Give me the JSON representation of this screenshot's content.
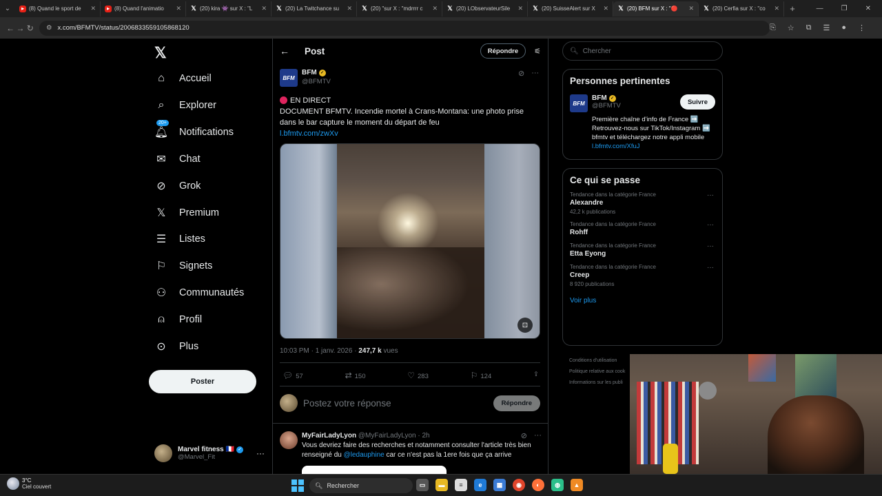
{
  "browser": {
    "tabs": [
      {
        "title": "(8) Quand le sport de",
        "icon": "youtube-icon"
      },
      {
        "title": "(8) Quand l'animatio",
        "icon": "youtube-icon"
      },
      {
        "title": "(20) kira 👾 sur X : \"L",
        "icon": "x-icon"
      },
      {
        "title": "(20) La Twitchance su",
        "icon": "x-icon"
      },
      {
        "title": "(20) \"sur X : \"mdrrrr c",
        "icon": "x-icon"
      },
      {
        "title": "(20) LObservateurSile",
        "icon": "x-icon"
      },
      {
        "title": "(20) SuisseAlert sur X",
        "icon": "x-icon"
      },
      {
        "title": "(20) BFM sur X : \"🔴",
        "icon": "x-icon",
        "active": true
      },
      {
        "title": "(20) Cerfia sur X : \"co",
        "icon": "x-icon"
      }
    ],
    "url": "x.com/BFMTV/status/2006833559105868120"
  },
  "nav": {
    "items": [
      {
        "label": "Accueil",
        "icon": "home-icon"
      },
      {
        "label": "Explorer",
        "icon": "search-icon"
      },
      {
        "label": "Notifications",
        "icon": "bell-icon",
        "badge": "20+"
      },
      {
        "label": "Chat",
        "icon": "mail-icon"
      },
      {
        "label": "Grok",
        "icon": "grok-icon"
      },
      {
        "label": "Premium",
        "icon": "x-logo-icon"
      },
      {
        "label": "Listes",
        "icon": "list-icon"
      },
      {
        "label": "Signets",
        "icon": "bookmark-icon"
      },
      {
        "label": "Communautés",
        "icon": "communities-icon"
      },
      {
        "label": "Profil",
        "icon": "user-icon"
      },
      {
        "label": "Plus",
        "icon": "more-circle-icon"
      }
    ],
    "post_button": "Poster",
    "account": {
      "name": "Marvel fitness 🇫🇷",
      "handle": "@Marvel_Fit"
    }
  },
  "main": {
    "header_title": "Post",
    "reply_button": "Répondre",
    "post": {
      "author_name": "BFM",
      "author_handle": "@BFMTV",
      "logo_text": "BFM",
      "live": "EN DIRECT",
      "text": "DOCUMENT BFMTV. Incendie mortel à Crans-Montana: une photo prise dans le bar capture le moment du départ de feu",
      "link": "l.bfmtv.com/zwXv",
      "time": "10:03 PM · 1 janv. 2026 · ",
      "views_count": "247,7 k",
      "views_label": " vues",
      "replies": "57",
      "reposts": "150",
      "likes": "283",
      "bookmarks": "124"
    },
    "compose_placeholder": "Postez votre réponse",
    "compose_button": "Répondre",
    "reply": {
      "name": "MyFairLadyLyon",
      "handle": "@MyFairLadyLyon · 2h",
      "text_before": "Vous devriez faire des recherches et notamment consulter l'article très bien renseigné du ",
      "mention": "@ledauphine",
      "text_after": " car ce n'est pas la 1ere fois que ça arrive"
    }
  },
  "right": {
    "search_placeholder": "Chercher",
    "people_title": "Personnes pertinentes",
    "person": {
      "name": "BFM",
      "handle": "@BFMTV",
      "follow": "Suivre",
      "bio": "Première chaîne d'info de France ➡️ Retrouvez-nous sur TikTok/Instagram ➡️ bfmtv et téléchargez notre appli mobile ",
      "bio_link": "l.bfmtv.com/XfuJ"
    },
    "trends_title": "Ce qui se passe",
    "trends": [
      {
        "category": "Tendance dans la catégorie France",
        "name": "Alexandre",
        "count": "42,2 k publications"
      },
      {
        "category": "Tendance dans la catégorie France",
        "name": "Rohff",
        "count": ""
      },
      {
        "category": "Tendance dans la catégorie France",
        "name": "Etta Eyong",
        "count": ""
      },
      {
        "category": "Tendance dans la catégorie France",
        "name": "Creep",
        "count": "8 920 publications"
      }
    ],
    "see_more": "Voir plus",
    "footer": [
      "Conditions d'utilisation",
      "Politique relative aux cook",
      "Informations sur les publi"
    ]
  },
  "taskbar": {
    "temperature": "3°C",
    "condition": "Ciel couvert",
    "search": "Rechercher"
  },
  "colors": {
    "accent": "#1d9bf0",
    "background": "#000000",
    "verified_gold": "#e8b923",
    "live_red": "#e0245e"
  }
}
